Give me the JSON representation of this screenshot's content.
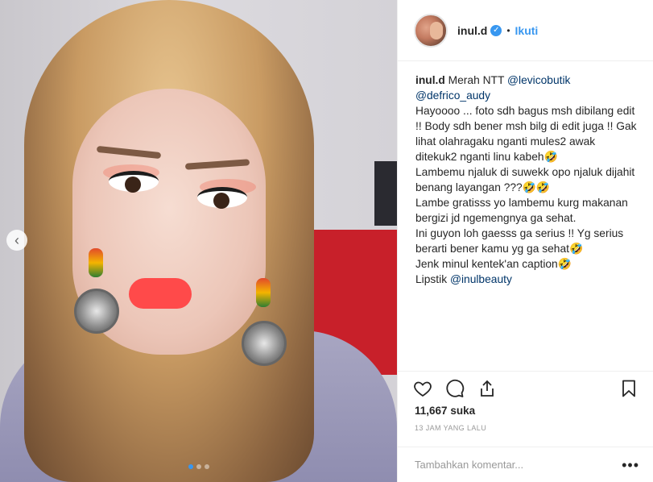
{
  "post": {
    "carousel": {
      "prev_icon": "chevron-left-icon",
      "dot_count": 3,
      "active_index": 0
    },
    "accent_color": "#3897f0"
  },
  "header": {
    "username": "inul.d",
    "verified_icon": "verified-badge-icon",
    "separator": "•",
    "follow_label": "Ikuti"
  },
  "caption": {
    "username": "inul.d",
    "intro": "Merah NTT",
    "mention1": "@levicobutik",
    "mention2": "@defrico_audy",
    "lines": [
      "Hayoooo ... foto sdh bagus msh dibilang edit !! Body sdh bener msh bilg di edit juga !! Gak lihat olahragaku nganti mules2 awak ditekuk2 nganti linu kabeh🤣",
      "Lambemu njaluk di suwekk opo njaluk dijahit benang layangan ???🤣🤣",
      "Lambe gratisss yo lambemu kurg makanan bergizi jd ngemengnya ga sehat.",
      "Ini guyon loh gaesss ga serius !! Yg serius berarti bener kamu yg ga sehat🤣",
      "Jenk minul kentek'an caption🤣"
    ],
    "lipstik_label": "Lipstik",
    "lipstik_mention": "@inulbeauty"
  },
  "actions": {
    "like_icon": "heart-icon",
    "comment_icon": "comment-icon",
    "share_icon": "share-icon",
    "bookmark_icon": "bookmark-icon"
  },
  "likes": {
    "count": "11,667",
    "unit": "suka"
  },
  "timestamp": "13 JAM YANG LALU",
  "comment_box": {
    "placeholder": "Tambahkan komentar...",
    "more_label": "•••"
  }
}
